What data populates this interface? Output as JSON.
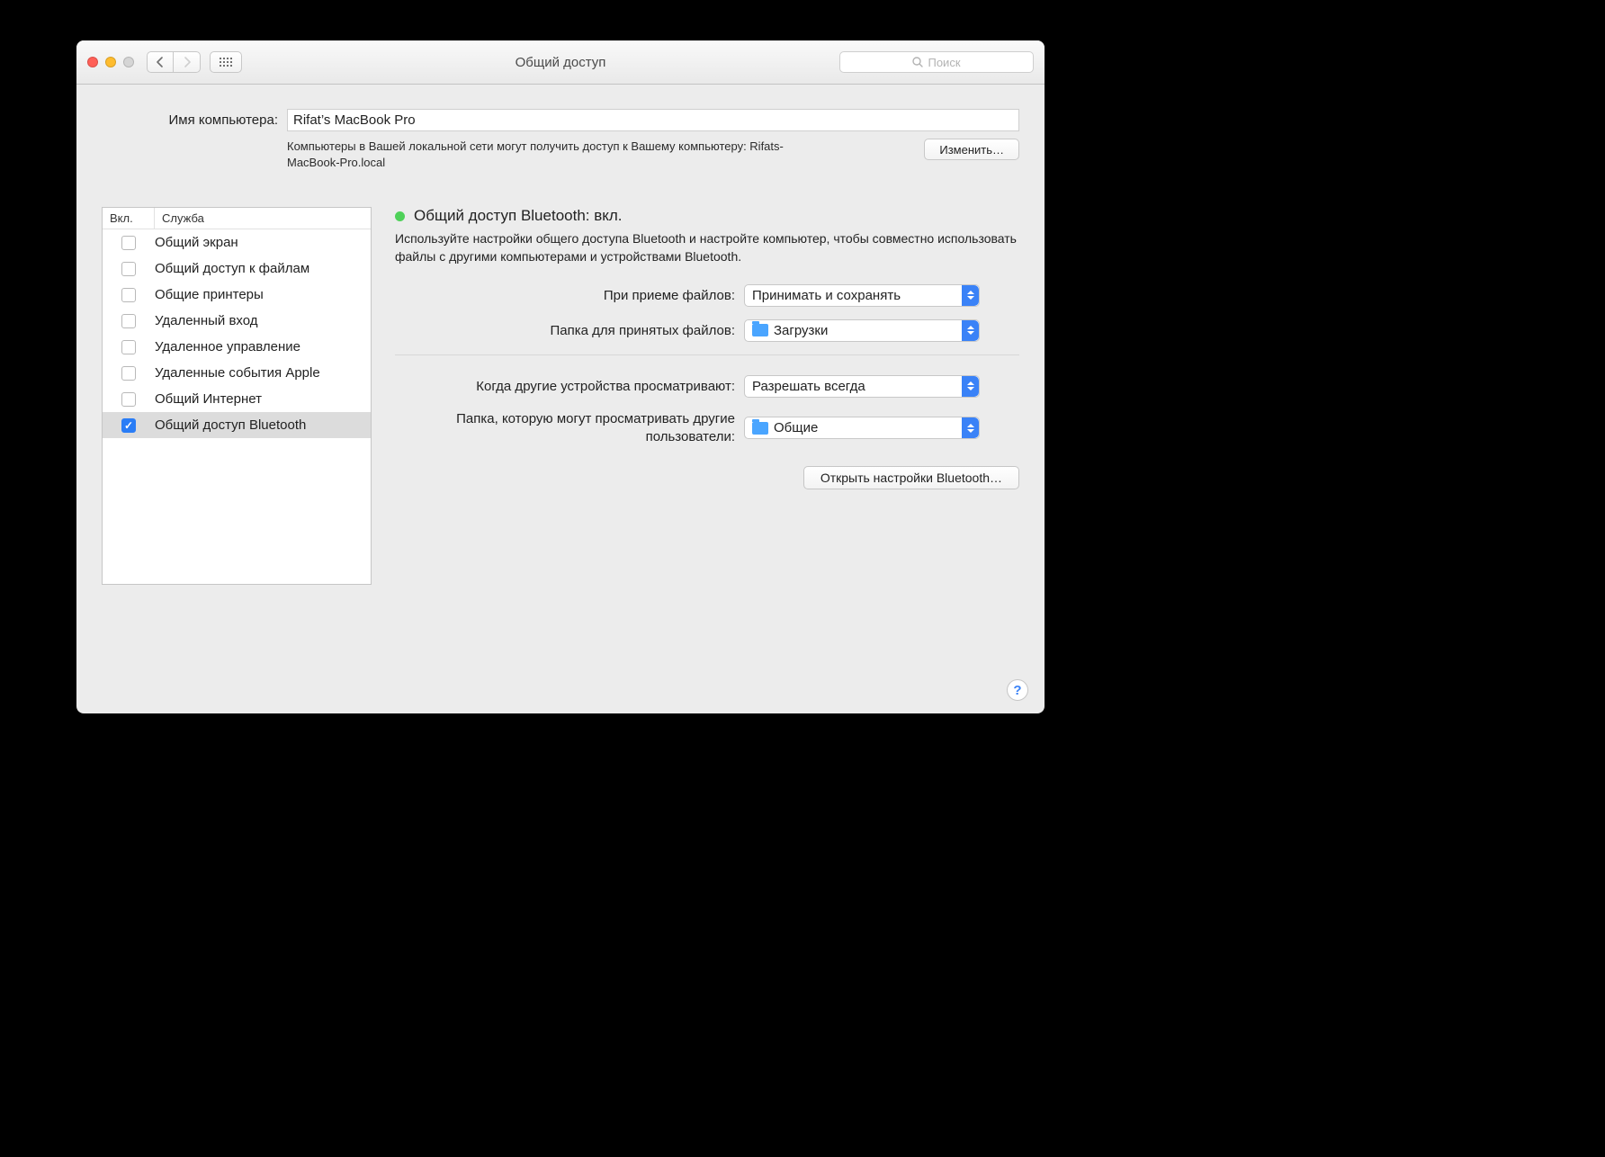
{
  "title": "Общий доступ",
  "search_placeholder": "Поиск",
  "computer_name_label": "Имя компьютера:",
  "computer_name": "Rifat’s MacBook Pro",
  "computer_desc": "Компьютеры в Вашей локальной сети могут получить доступ к Вашему компьютеру: Rifats-MacBook-Pro.local",
  "edit_button": "Изменить…",
  "sidebar": {
    "head_on": "Вкл.",
    "head_service": "Служба",
    "items": [
      {
        "checked": false,
        "label": "Общий экран"
      },
      {
        "checked": false,
        "label": "Общий доступ к файлам"
      },
      {
        "checked": false,
        "label": "Общие принтеры"
      },
      {
        "checked": false,
        "label": "Удаленный вход"
      },
      {
        "checked": false,
        "label": "Удаленное управление"
      },
      {
        "checked": false,
        "label": "Удаленные события Apple"
      },
      {
        "checked": false,
        "label": "Общий Интернет"
      },
      {
        "checked": true,
        "label": "Общий доступ Bluetooth"
      }
    ],
    "selected_index": 7
  },
  "detail": {
    "status": "Общий доступ Bluetooth: вкл.",
    "desc": "Используйте настройки общего доступа Bluetooth и настройте компьютер, чтобы совместно использовать файлы с другими компьютерами и устройствами Bluetooth.",
    "opt1_label": "При приеме файлов:",
    "opt1_value": "Принимать и сохранять",
    "opt2_label": "Папка для принятых файлов:",
    "opt2_value": "Загрузки",
    "opt3_label": "Когда другие устройства просматривают:",
    "opt3_value": "Разрешать всегда",
    "opt4_label": "Папка, которую могут просматривать другие пользователи:",
    "opt4_value": "Общие",
    "bt_button": "Открыть настройки Bluetooth…"
  }
}
